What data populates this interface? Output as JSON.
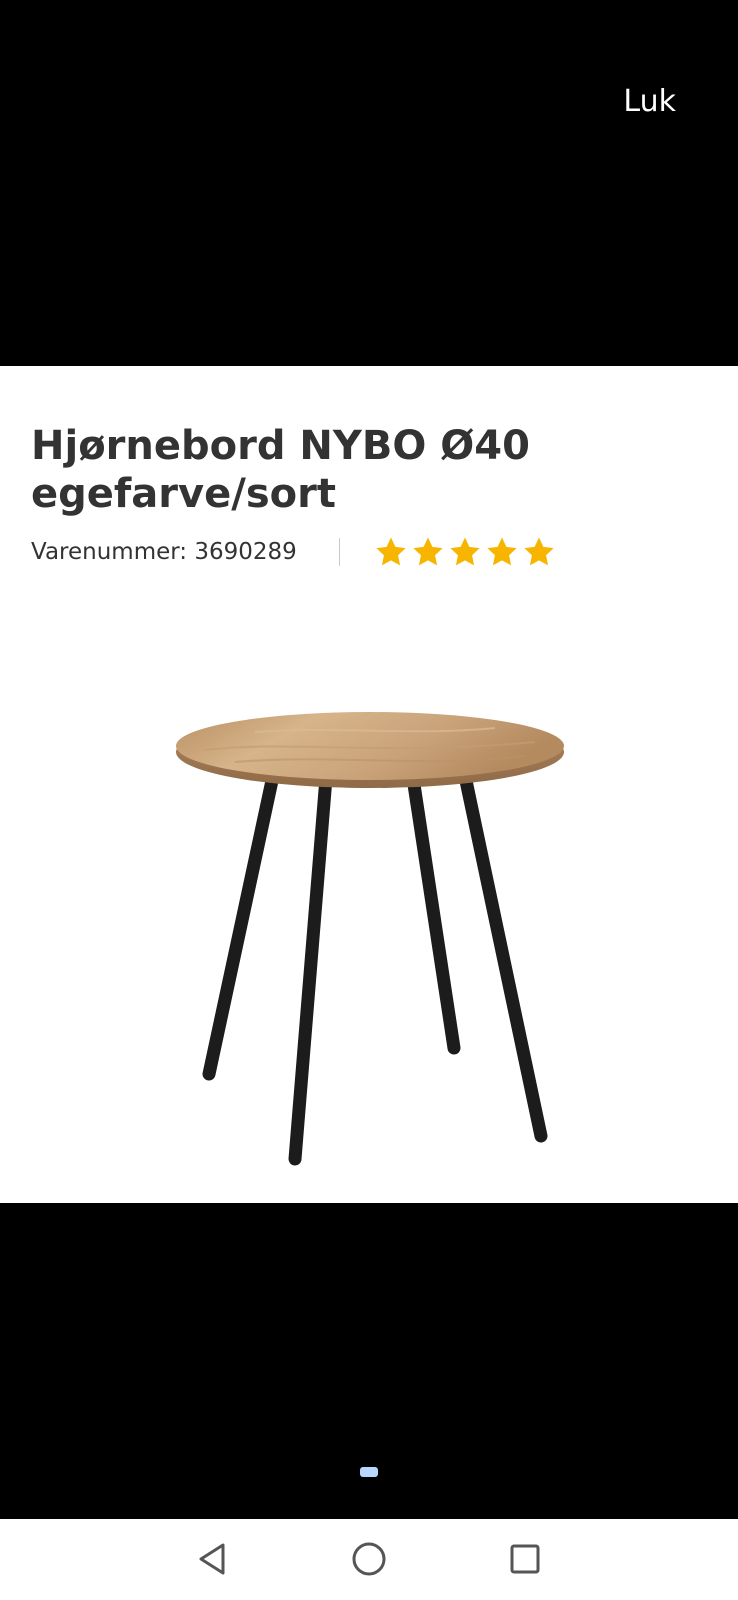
{
  "viewer": {
    "close_label": "Luk"
  },
  "product": {
    "title": "Hjørnebord NYBO Ø40 egefarve/sort",
    "sku_label": "Varenummer: 3690289",
    "rating": 5,
    "rating_max": 5,
    "star_color": "#f7b500",
    "image": {
      "icon": "table-product-image",
      "tabletop_color": "#c9a27a",
      "legs_color": "#1c1c1c"
    }
  },
  "pager": {
    "slides": 1,
    "active_index": 0,
    "active_color": "#b9d6ff"
  },
  "system_nav": {
    "back_icon": "triangle-back-icon",
    "home_icon": "circle-home-icon",
    "recents_icon": "square-recents-icon"
  }
}
